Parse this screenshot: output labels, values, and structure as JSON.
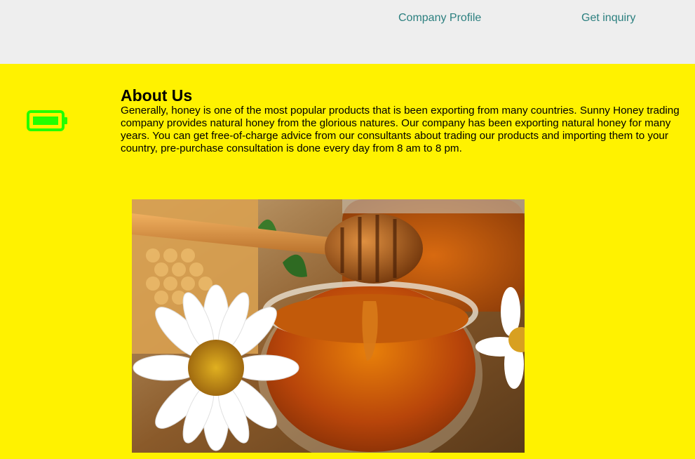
{
  "nav": {
    "company_profile": "Company Profile",
    "get_inquiry": "Get inquiry"
  },
  "about": {
    "title": "About Us",
    "body": "Generally, honey is one of the most popular products that is been exporting from many countries. Sunny Honey trading company provides natural honey from the glorious natures. Our company has been exporting natural honey for many years. You can get free-of-charge advice from our consultants about trading our products and importing them to your country, pre-purchase consultation is done every day from 8 am to 8 pm."
  },
  "icons": {
    "battery": "battery-full-icon"
  },
  "colors": {
    "header_bg": "#eeeeee",
    "main_bg": "#fff200",
    "link": "#2b7f7f",
    "battery": "#22ff00"
  }
}
